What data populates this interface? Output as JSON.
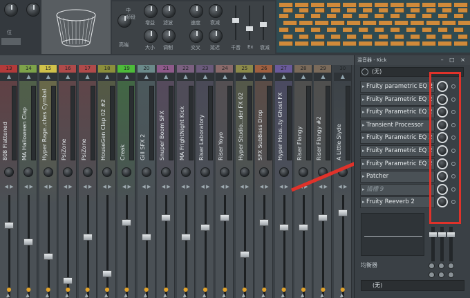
{
  "top_panel": {
    "labels": [
      "低",
      "中",
      "频段",
      "高端",
      "大小",
      "调制",
      "增益",
      "滤波",
      "速度",
      "衰减",
      "延迟",
      "交叉",
      "千音",
      "Ex",
      "衰减"
    ],
    "left_label": "位"
  },
  "mixer": {
    "strips": [
      {
        "num": "13",
        "name": "808 Flattened",
        "color": "#b33a3a"
      },
      {
        "num": "14",
        "name": "MA Halloween Clap",
        "color": "#7ea34a"
      },
      {
        "num": "15",
        "name": "Hyper Rage..ches Cymbal",
        "color": "#d1c24a"
      },
      {
        "num": "16",
        "name": "PsiZone",
        "color": "#b04a4a"
      },
      {
        "num": "17",
        "name": "PsiZone",
        "color": "#b04a4a"
      },
      {
        "num": "18",
        "name": "HouseGen Clap 02 #2",
        "color": "#8c8f3c"
      },
      {
        "num": "19",
        "name": "Creak",
        "color": "#4dbb3a"
      },
      {
        "num": "20",
        "name": "Gill SFX 2",
        "color": "#6b8a8a"
      },
      {
        "num": "21",
        "name": "Snuper Boom SFX",
        "color": "#8e5a8a"
      },
      {
        "num": "22",
        "name": "MA FrightNight Kick",
        "color": "#7b6080"
      },
      {
        "num": "23",
        "name": "Riser Laboratory",
        "color": "#6a5a7a"
      },
      {
        "num": "24",
        "name": "Riser Yoyo",
        "color": "#8a6a6a"
      },
      {
        "num": "25",
        "name": "Hyper Studio...der FX 02",
        "color": "#8c8a4a"
      },
      {
        "num": "26",
        "name": "SFX SubBass Drop",
        "color": "#a06040"
      },
      {
        "num": "27",
        "name": "Hyper Hous..ty Ghost FX",
        "color": "#6a5a9a"
      },
      {
        "num": "28",
        "name": "Riser Flangy",
        "color": "#7a6a5a"
      },
      {
        "num": "29",
        "name": "Riser Flangy #2",
        "color": "#7a6a5a"
      },
      {
        "num": "30",
        "name": "A Little Slyde",
        "color": "#3a4045"
      }
    ],
    "fader_levels": [
      0.72,
      0.55,
      0.4,
      0.15,
      0.6,
      0.22,
      0.75,
      0.6,
      0.8,
      0.6,
      0.7,
      0.8,
      0.42,
      0.75,
      0.7,
      0.7,
      0.8,
      0.85
    ]
  },
  "panel": {
    "title": "混音器 - Kick",
    "window_controls": "– □ ×",
    "preset": "(无)",
    "slots": [
      {
        "label": "Fruity parametric EQ 2",
        "empty": false
      },
      {
        "label": "Fruity Parametric EQ 2",
        "empty": false
      },
      {
        "label": "Fruity Parametric EQ 2",
        "empty": false
      },
      {
        "label": "Transient Processor",
        "empty": false
      },
      {
        "label": "Fruity Parametric EQ 2",
        "empty": false
      },
      {
        "label": "Fruity Parametric EQ 2",
        "empty": false
      },
      {
        "label": "Fruity Parametric EQ 2",
        "empty": false
      },
      {
        "label": "Patcher",
        "empty": false
      },
      {
        "label": "插槽 9",
        "empty": true
      },
      {
        "label": "Fruity Reeverb 2",
        "empty": false
      }
    ],
    "eq_label": "均衡器",
    "bottom_preset": "(无)"
  },
  "colors": {
    "highlight_red": "#e0322a",
    "arrow_red": "#e0322a"
  }
}
